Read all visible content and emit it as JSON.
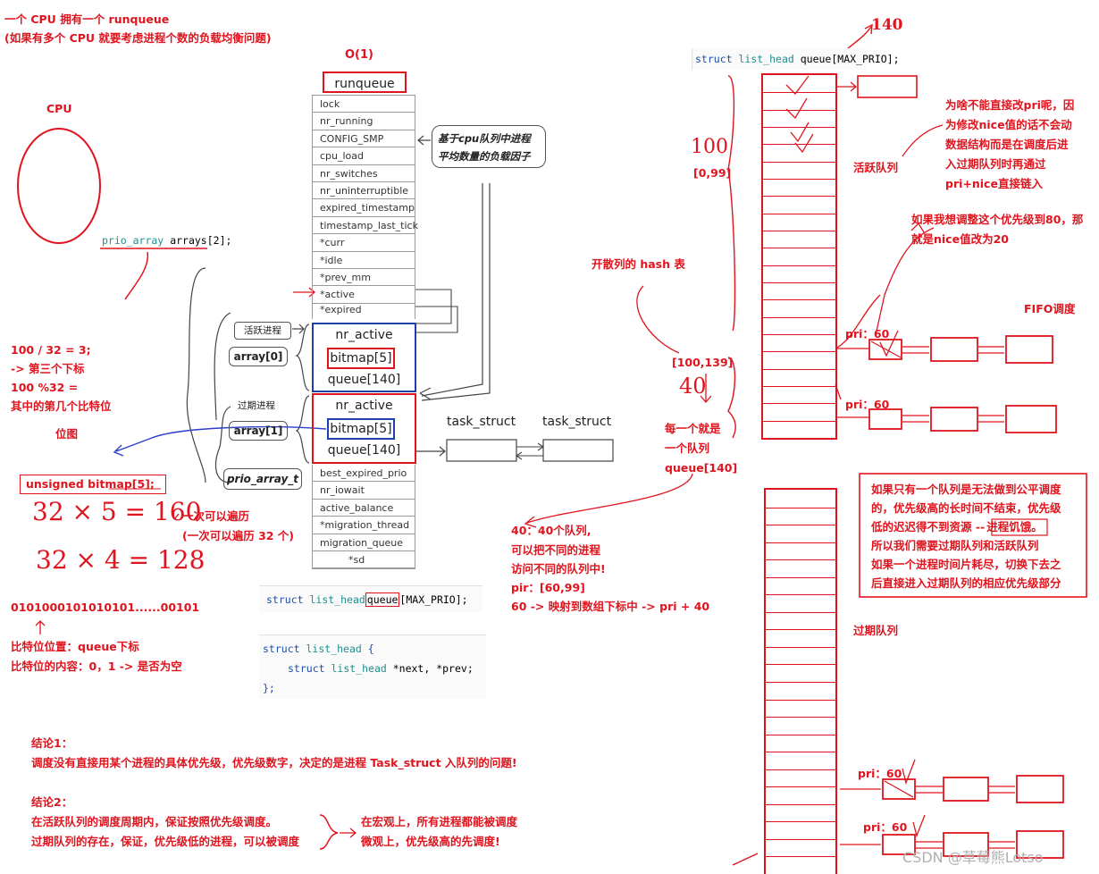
{
  "left_notes": {
    "title_line1": "一个 CPU 拥有一个 runqueue",
    "title_line2": "(如果有多个 CPU 就要考虑进程个数的负载均衡问题)",
    "cpu_label": "CPU",
    "calc_line1": "100 / 32   = 3;",
    "calc_line2": "-> 第三个下标",
    "calc_line3": "100 %32 =",
    "calc_line4": "其中的第几个比特位",
    "bitmap_label": "位图",
    "bitmap_decl": "unsigned bitmap[5];",
    "hand_32x5": "32 × 5 = 160",
    "traverse_once_1": "一次可以遍历",
    "traverse_once_2": "(一次可以遍历 32 个)",
    "hand_32x4": "32 × 4  = 128",
    "bits": "0101000101010101......00101",
    "bitpos_1": "比特位位置：queue下标",
    "bitpos_2": "比特位的内容：0，1 -> 是否为空",
    "concl1_title": "结论1：",
    "concl1_text": "调度没有直接用某个进程的具体优先级，优先级数字，决定的是进程 Task_struct 入队列的问题!",
    "concl2_title": "结论2：",
    "concl2_line1": "在活跃队列的调度周期内，保证按照优先级调度。",
    "concl2_line2": "过期队列的存在，保证，优先级低的进程，可以被调度",
    "macro_line1": "在宏观上，所有进程都能被调度",
    "macro_line2": "微观上，优先级高的先调度!"
  },
  "prio_code": {
    "type": "prio_array",
    "name": "arrays",
    "index": "[2];"
  },
  "runqueue": {
    "o1": "O(1)",
    "title": "runqueue",
    "fields_top": [
      "lock",
      "nr_running",
      "CONFIG_SMP",
      "cpu_load",
      "nr_switches",
      "nr_uninterruptible",
      "expired_timestamp",
      "timestamp_last_tick",
      "*curr",
      "*idle",
      "*prev_mm",
      "*active",
      "*expired"
    ],
    "array0": [
      "nr_active",
      "bitmap[5]",
      "queue[140]"
    ],
    "array1": [
      "nr_active",
      "bitmap[5]",
      "queue[140]"
    ],
    "fields_bottom": [
      "best_expired_prio",
      "nr_iowait",
      "active_balance",
      "*migration_thread",
      "migration_queue",
      "*sd"
    ],
    "active_tag": "活跃进程",
    "expired_tag": "过期进程",
    "array0_label": "array[0]",
    "array1_label": "array[1]",
    "prio_array_t": "prio_array_t",
    "callout_line1": "基于cpu队列中进程",
    "callout_line2": "平均数量的负载因子",
    "task1": "task_struct",
    "task2": "task_struct"
  },
  "code_blocks": {
    "list_queue_kw": "struct",
    "list_queue_type": "list_head",
    "list_queue_name": "queue",
    "list_queue_rest": "[MAX_PRIO];",
    "lh_kw": "struct",
    "lh_type": "list_head",
    "lh_brace": "{",
    "lh_inner_kw": "struct",
    "lh_inner_type": "list_head",
    "lh_inner_rest": "*next, *prev;",
    "lh_close": "};",
    "top_kw": "struct",
    "top_type": "list_head",
    "top_rest": "queue[MAX_PRIO];"
  },
  "middle_notes": {
    "hash_label": "开散列的 hash 表",
    "range_100_139": "[100,139]",
    "hand_40": "40",
    "each_queue_1": "每一个就是",
    "each_queue_2": "一个队列",
    "each_queue_3": "queue[140]",
    "n40_line1": "40：40个队列,",
    "n40_line2": "可以把不同的进程",
    "n40_line3": "访问不同的队列中!",
    "n40_line4": "pir：[60,99]",
    "n40_line5": "60 -> 映射到数组下标中 -> pri + 40"
  },
  "right_notes": {
    "hand_140": "140",
    "hand_100": "100",
    "range_0_99": "[0,99]",
    "active_queue": "活跃队列",
    "why_1": "为啥不能直接改pri呢，因",
    "why_2": "为修改nice值的话不会动",
    "why_3": "数据结构而是在调度后进",
    "why_4": "入过期队列时再通过",
    "why_5": "pri+nice直接链入",
    "adj_1": "如果我想调整这个优先级到80，那",
    "adj_2": "就是nice值改为20",
    "fifo": "FIFO调度",
    "pri60_a": "pri：60",
    "pri60_b": "pri：60",
    "pri60_c": "pri：60",
    "pri60_d": "pri：60",
    "box_1": "如果只有一个队列是无法做到公平调度",
    "box_2": "的，优先级高的长时间不结束，优先级",
    "box_3": "低的迟迟得不到资源 --",
    "box_3b": "进程饥饿。",
    "box_4": "所以我们需要过期队列和活跃队列",
    "box_5": "如果一个进程时间片耗尽，切换下去之",
    "box_6": "后直接进入过期队列的相应优先级部分",
    "expired_queue": "过期队列",
    "watermark": "CSDN @草莓熊Lotso"
  },
  "colors": {
    "annotation": "#e0141e",
    "struct_border": "#1f3fae",
    "keyword": "#1a4fb0"
  }
}
